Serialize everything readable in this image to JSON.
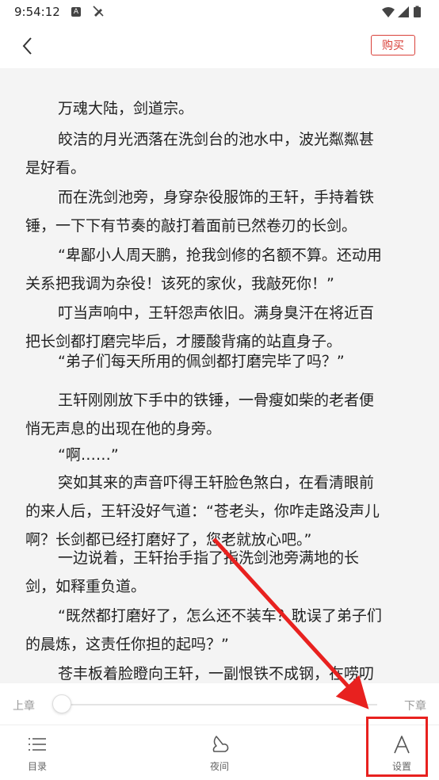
{
  "status_bar": {
    "time": "9:54:12",
    "notif_icon": "A"
  },
  "header": {
    "buy_label": "购买"
  },
  "reader": {
    "paragraphs": [
      {
        "lines": [
          "万魂大陆，剑道宗。"
        ]
      },
      {
        "lines": [
          "皎洁的月光洒落在洗剑台的池水中，波光粼粼甚",
          "是好看。"
        ]
      },
      {
        "lines": [
          "而在洗剑池旁，身穿杂役服饰的王轩，手持着铁",
          "锤，一下下有节奏的敲打着面前已然卷刃的长剑。"
        ]
      },
      {
        "lines": [
          "“卑鄙小人周天鹏，抢我剑修的名额不算。还动用",
          "关系把我调为杂役！该死的家伙，我敲死你！”"
        ]
      },
      {
        "lines": [
          "叮当声响中，王轩怨声依旧。满身臭汗在将近百",
          "把长剑都打磨完毕后，才腰酸背痛的站直身子。"
        ]
      },
      {
        "lines": [
          "“弟子们每天所用的佩剑都打磨完毕了吗？”"
        ]
      },
      {
        "lines": [
          "王轩刚刚放下手中的铁锤，一骨瘦如柴的老者便",
          "悄无声息的出现在他的身旁。"
        ]
      },
      {
        "lines": [
          "“啊……”"
        ]
      },
      {
        "lines": [
          "突如其来的声音吓得王轩脸色煞白，在看清眼前",
          "的来人后，王轩没好气道：“苍老头，你咋走路没声儿",
          "啊？长剑都已经打磨好了，您老就放心吧。”"
        ]
      },
      {
        "lines": [
          "一边说着，王轩抬手指了指洗剑池旁满地的长",
          "剑，如释重负道。"
        ]
      },
      {
        "lines": [
          "“既然都打磨好了，怎么还不装车？耽误了弟子们",
          "的晨炼，这责任你担的起吗？”"
        ]
      },
      {
        "lines": [
          "苍丰板着脸瞪向王轩，一副恨铁不成钢，在唠叨"
        ]
      }
    ]
  },
  "progress": {
    "prev_label": "上章",
    "next_label": "下章",
    "fraction": 0
  },
  "bottom_nav": [
    {
      "label": "目录",
      "icon": "list-icon"
    },
    {
      "label": "夜间",
      "icon": "night-mode-icon"
    },
    {
      "label": "设置",
      "icon": "font-settings-icon"
    }
  ],
  "colors": {
    "accent_red": "#d9413a",
    "annotation_red": "#e8211f",
    "page_bg": "#f4f4f4"
  }
}
